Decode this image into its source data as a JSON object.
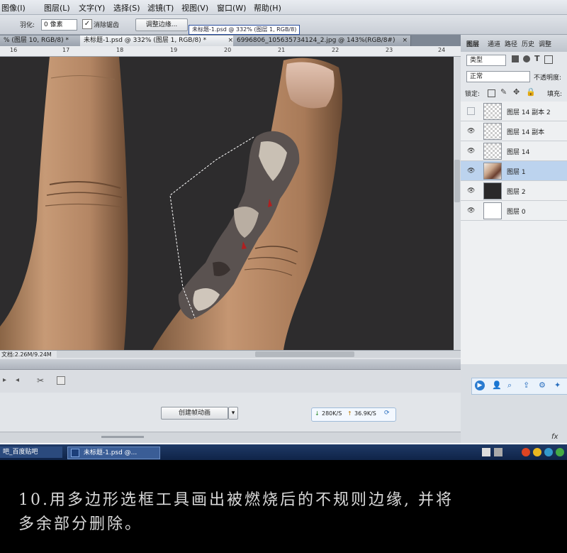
{
  "menu": [
    "图像(I)",
    "图层(L)",
    "文字(Y)",
    "选择(S)",
    "滤镜(T)",
    "视图(V)",
    "窗口(W)",
    "帮助(H)"
  ],
  "options": {
    "feather_label": "羽化:",
    "feather_value": "0 像素",
    "antialias_label": "消除锯齿",
    "antialias_checked": true,
    "refine_button": "调整边缘...",
    "tooltip": "未标题-1.psd @ 332% (图层 1, RGB/8)"
  },
  "tabs": [
    {
      "label": "% (图层 10, RGB/8) *",
      "close": "×"
    },
    {
      "label": "未标题-1.psd @ 332% (图层 1, RGB/8) *",
      "close": "×",
      "active": true
    },
    {
      "label": "6996806_105635734124_2.jpg @ 143%(RGB/8#)",
      "close": "×"
    }
  ],
  "ruler": [
    "16",
    "17",
    "18",
    "19",
    "20",
    "21",
    "22",
    "23",
    "24"
  ],
  "status": {
    "doc": "文档:2.26M/9.24M"
  },
  "timeline": {
    "create_button": "创建帧动画"
  },
  "net_speed": {
    "down": "280K/S",
    "up": "36.9K/S"
  },
  "layers_panel": {
    "tabs": [
      "图层",
      "通道",
      "路径",
      "历史",
      "调整"
    ],
    "filter": "类型",
    "blend": "正常",
    "opacity_label": "不透明度:",
    "lock_label": "锁定:",
    "fill_label": "填充:",
    "fx_label": "fx"
  },
  "layers": [
    {
      "name": "图层 14 副本 2",
      "visible": false,
      "thumb": "transparent"
    },
    {
      "name": "图层 14 副本",
      "visible": true,
      "thumb": "transparent"
    },
    {
      "name": "图层 14",
      "visible": true,
      "thumb": "transparent"
    },
    {
      "name": "图层 1",
      "visible": true,
      "thumb": "image",
      "selected": true
    },
    {
      "name": "图层 2",
      "visible": true,
      "thumb": "dark"
    },
    {
      "name": "图层 0",
      "visible": true,
      "thumb": "white"
    }
  ],
  "taskbar": {
    "item1": "吧_百度贴吧",
    "item2": "未标题-1.psd @..."
  },
  "caption": {
    "line1": "10.用多边形选框工具画出被燃烧后的不规则边缘, 并将",
    "line2": "多余部分删除。"
  },
  "colors": {
    "canvas_bg": "#2d2c2d",
    "selected_layer": "#bcd3ee",
    "taskbar": "#1f3a66"
  }
}
